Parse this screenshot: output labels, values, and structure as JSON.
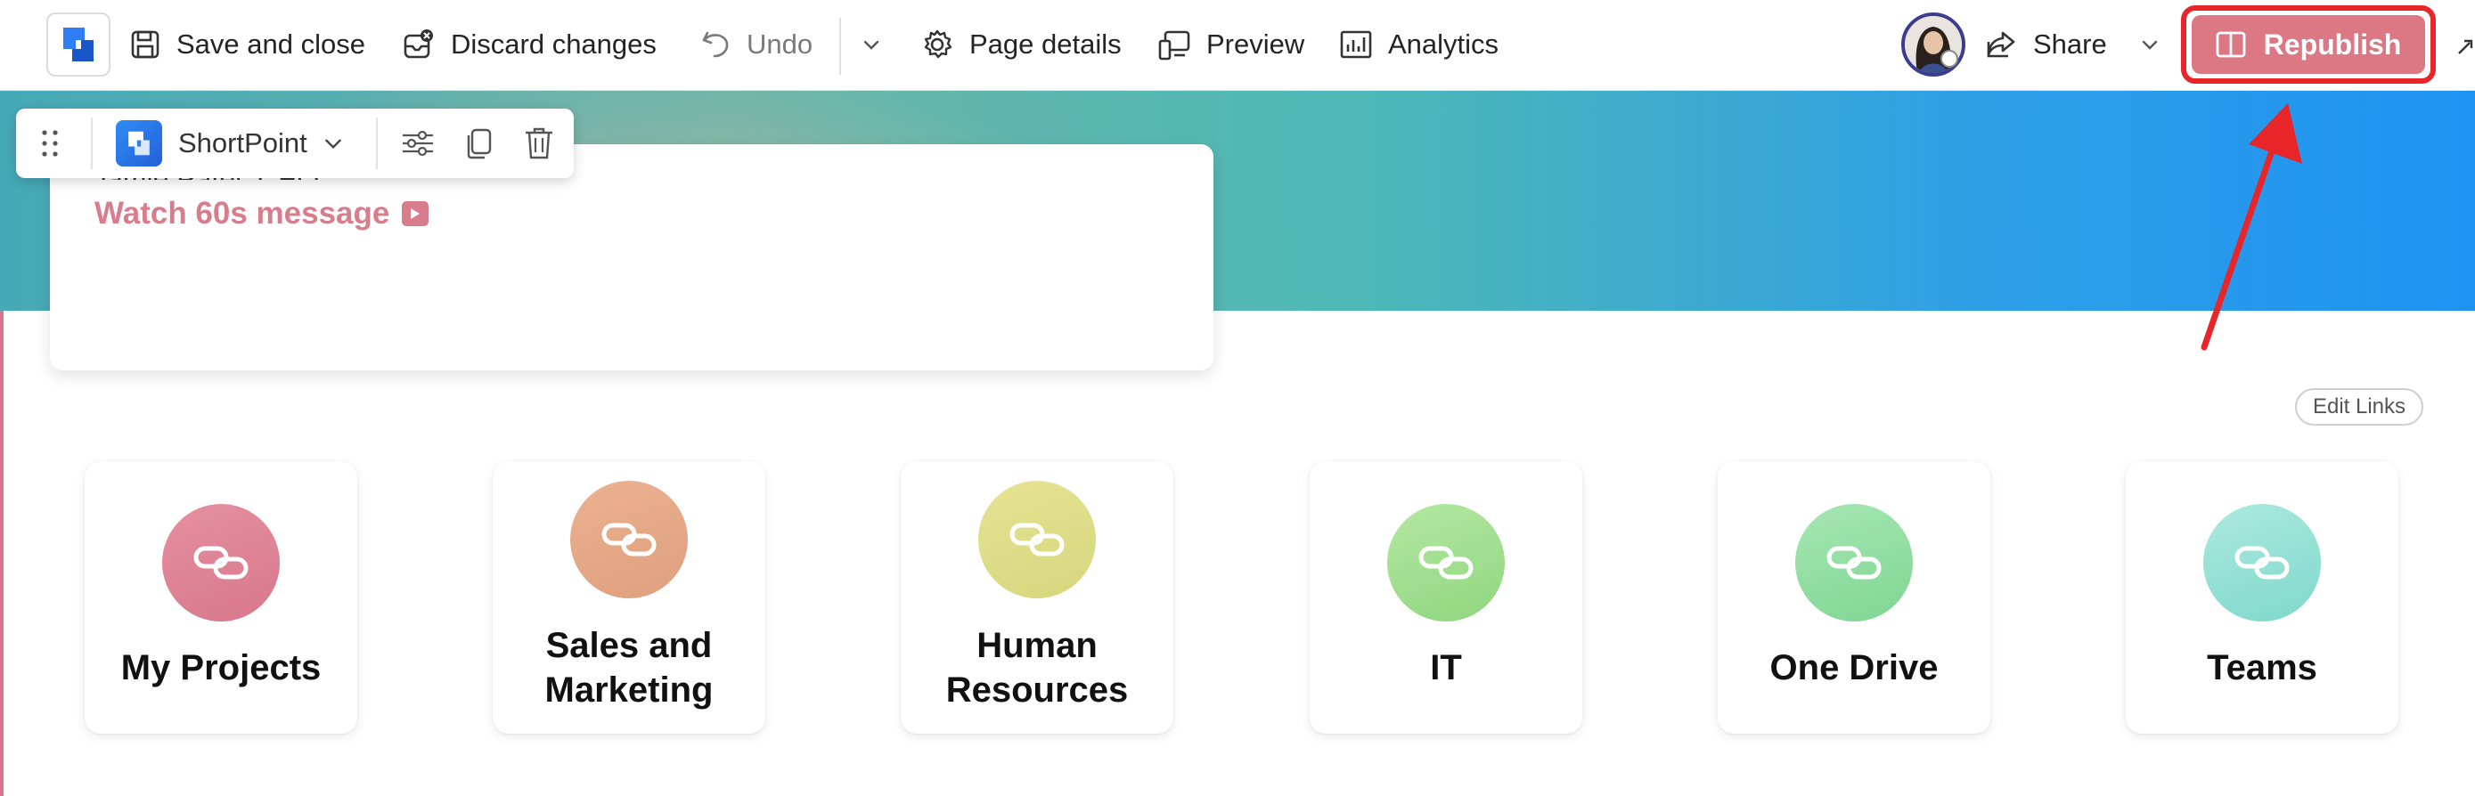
{
  "toolbar": {
    "save_close": "Save and close",
    "discard": "Discard changes",
    "undo": "Undo",
    "page_details": "Page details",
    "preview": "Preview",
    "analytics": "Analytics",
    "share": "Share",
    "republish": "Republish"
  },
  "hero": {
    "partial_text": "Jamie Patel, CEO",
    "watch_link": "Watch 60s message"
  },
  "webpart_toolbar": {
    "name": "ShortPoint"
  },
  "edit_links": "Edit Links",
  "quick_links": [
    {
      "line1": "My Projects",
      "line2": "",
      "color_a": "#e590a2",
      "color_b": "#d8778b"
    },
    {
      "line1": "Sales and",
      "line2": "Marketing",
      "color_a": "#ebb190",
      "color_b": "#dea07e"
    },
    {
      "line1": "Human",
      "line2": "Resources",
      "color_a": "#e6e394",
      "color_b": "#d5d77d"
    },
    {
      "line1": "IT",
      "line2": "",
      "color_a": "#b4e8a2",
      "color_b": "#8fd67f"
    },
    {
      "line1": "One Drive",
      "line2": "",
      "color_a": "#a7e6b4",
      "color_b": "#7fd692"
    },
    {
      "line1": "Teams",
      "line2": "",
      "color_a": "#aee9df",
      "color_b": "#7dd8cb"
    }
  ],
  "colors": {
    "accent": "#db7884",
    "highlight": "#e8262a",
    "link": "#d77d8c"
  }
}
